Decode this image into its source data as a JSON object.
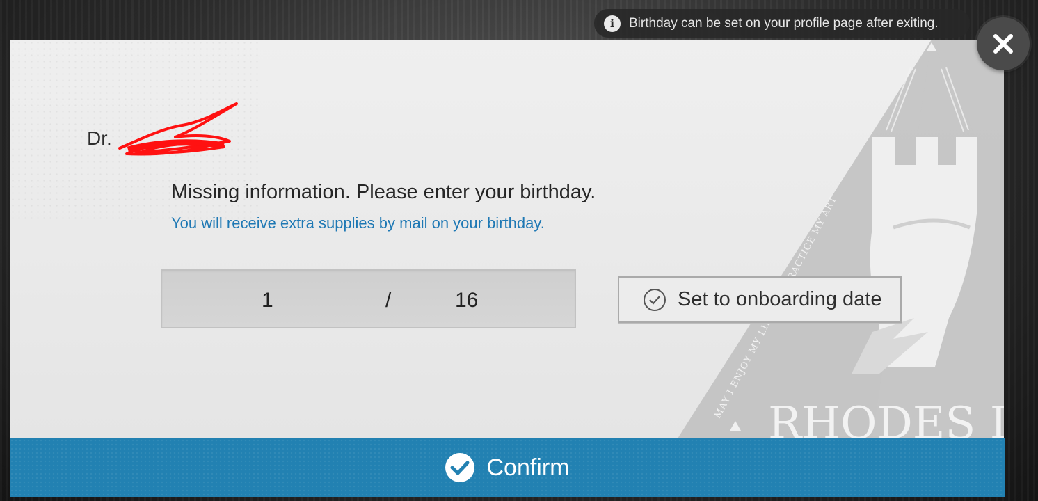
{
  "toast": {
    "icon": "info-icon",
    "text": "Birthday can be set on your profile page after exiting."
  },
  "dialog": {
    "doctor_prefix": "Dr.",
    "title": "Missing information. Please enter your birthday.",
    "subtitle": "You will receive extra supplies by mail on your birthday.",
    "birthday": {
      "month": "1",
      "separator": "/",
      "day": "16"
    },
    "onboarding_button": {
      "icon": "check-circle-icon",
      "label": "Set to onboarding date"
    },
    "emblem": {
      "motto": "MAY I ENJOY MY LIFE AND PRACTICE MY ART",
      "name": "RHODES ISL"
    }
  },
  "confirm": {
    "icon": "check-circle-filled-icon",
    "label": "Confirm"
  },
  "close": {
    "icon": "close-icon"
  },
  "colors": {
    "accent_blue": "#2281b2",
    "subtitle_blue": "#1e78b4",
    "redaction": "#ff0000"
  }
}
